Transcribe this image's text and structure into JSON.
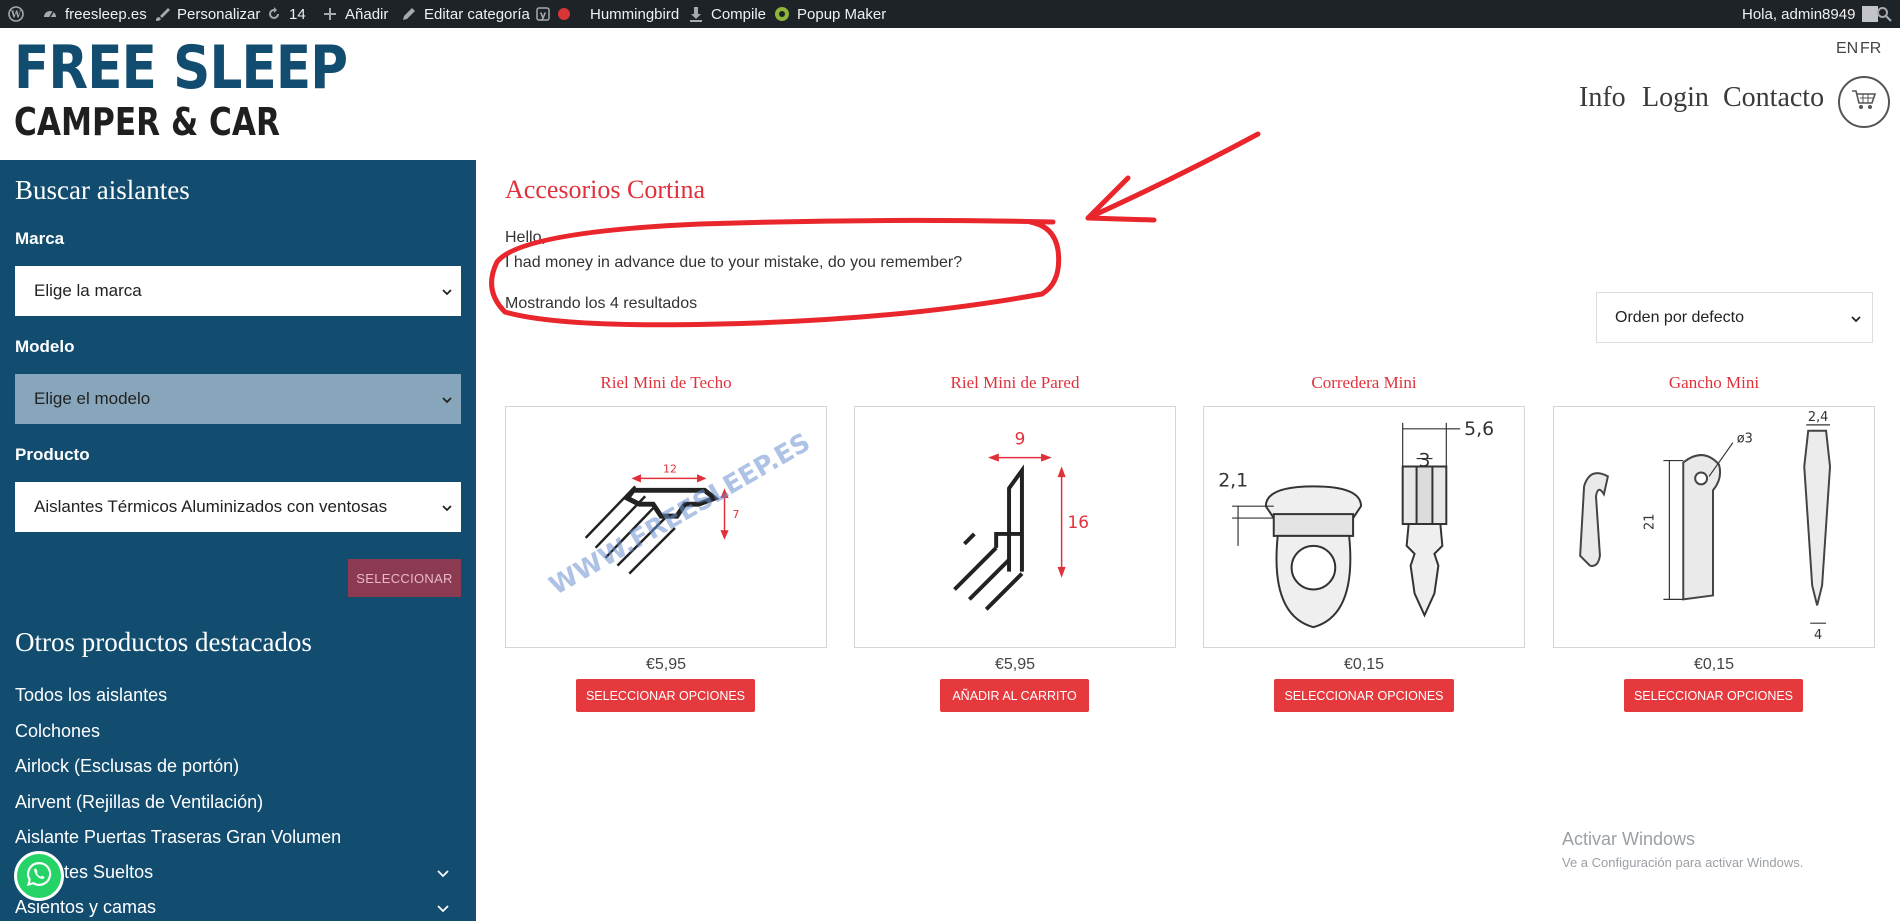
{
  "admin_bar": {
    "site": "freesleep.es",
    "customize": "Personalizar",
    "updates": "14",
    "add_new": "Añadir",
    "edit_category": "Editar categoría",
    "hummingbird": "Hummingbird",
    "compile": "Compile",
    "popup_maker": "Popup Maker",
    "greeting": "Hola, admin8949"
  },
  "header": {
    "logo_line1": "FREE SLEEP",
    "logo_line2": "CAMPER & CAR",
    "lang_en": "EN",
    "lang_fr": "FR",
    "nav_info": "Info",
    "nav_login": "Login",
    "nav_contact": "Contacto"
  },
  "sidebar": {
    "search_title": "Buscar aislantes",
    "brand_label": "Marca",
    "brand_value": "Elige la marca",
    "model_label": "Modelo",
    "model_value": "Elige el modelo",
    "product_label": "Producto",
    "product_value": "Aislantes Térmicos Aluminizados con ventosas",
    "select_button": "SELECCIONAR",
    "featured_title": "Otros productos destacados",
    "categories": [
      "Todos los aislantes",
      "Colchones",
      "Airlock (Esclusas de portón)",
      "Airvent (Rejillas de Ventilación)",
      "Aislante Puertas Traseras Gran Volumen",
      "Aislantes Sueltos",
      "Asientos y camas"
    ]
  },
  "main": {
    "title": "Accesorios Cortina",
    "desc_line1": "Hello,",
    "desc_line2": "I had money in advance due to your mistake, do you remember?",
    "results": "Mostrando los 4 resultados",
    "sort": "Orden por defecto",
    "products": [
      {
        "name": "Riel Mini de Techo",
        "price": "€5,95",
        "button": "SELECCIONAR OPCIONES",
        "dims": [
          "12",
          "7"
        ],
        "watermark": "WWW.FREESLEEP.ES"
      },
      {
        "name": "Riel Mini de Pared",
        "price": "€5,95",
        "button": "AÑADIR AL CARRITO",
        "dims": [
          "9",
          "16"
        ]
      },
      {
        "name": "Corredera Mini",
        "price": "€0,15",
        "button": "SELECCIONAR OPCIONES",
        "dims": [
          "5,6",
          "3",
          "2,1"
        ]
      },
      {
        "name": "Gancho Mini",
        "price": "€0,15",
        "button": "SELECCIONAR OPCIONES",
        "dims": [
          "2,4",
          "ø3",
          "21",
          "4"
        ]
      }
    ]
  },
  "watermark": {
    "line1": "Activar Windows",
    "line2": "Ve a Configuración para activar Windows."
  },
  "colors": {
    "brand_blue": "#124d70",
    "accent_red": "#e0313b",
    "button_red": "#e5393e",
    "annotation_red": "#e8262c"
  }
}
